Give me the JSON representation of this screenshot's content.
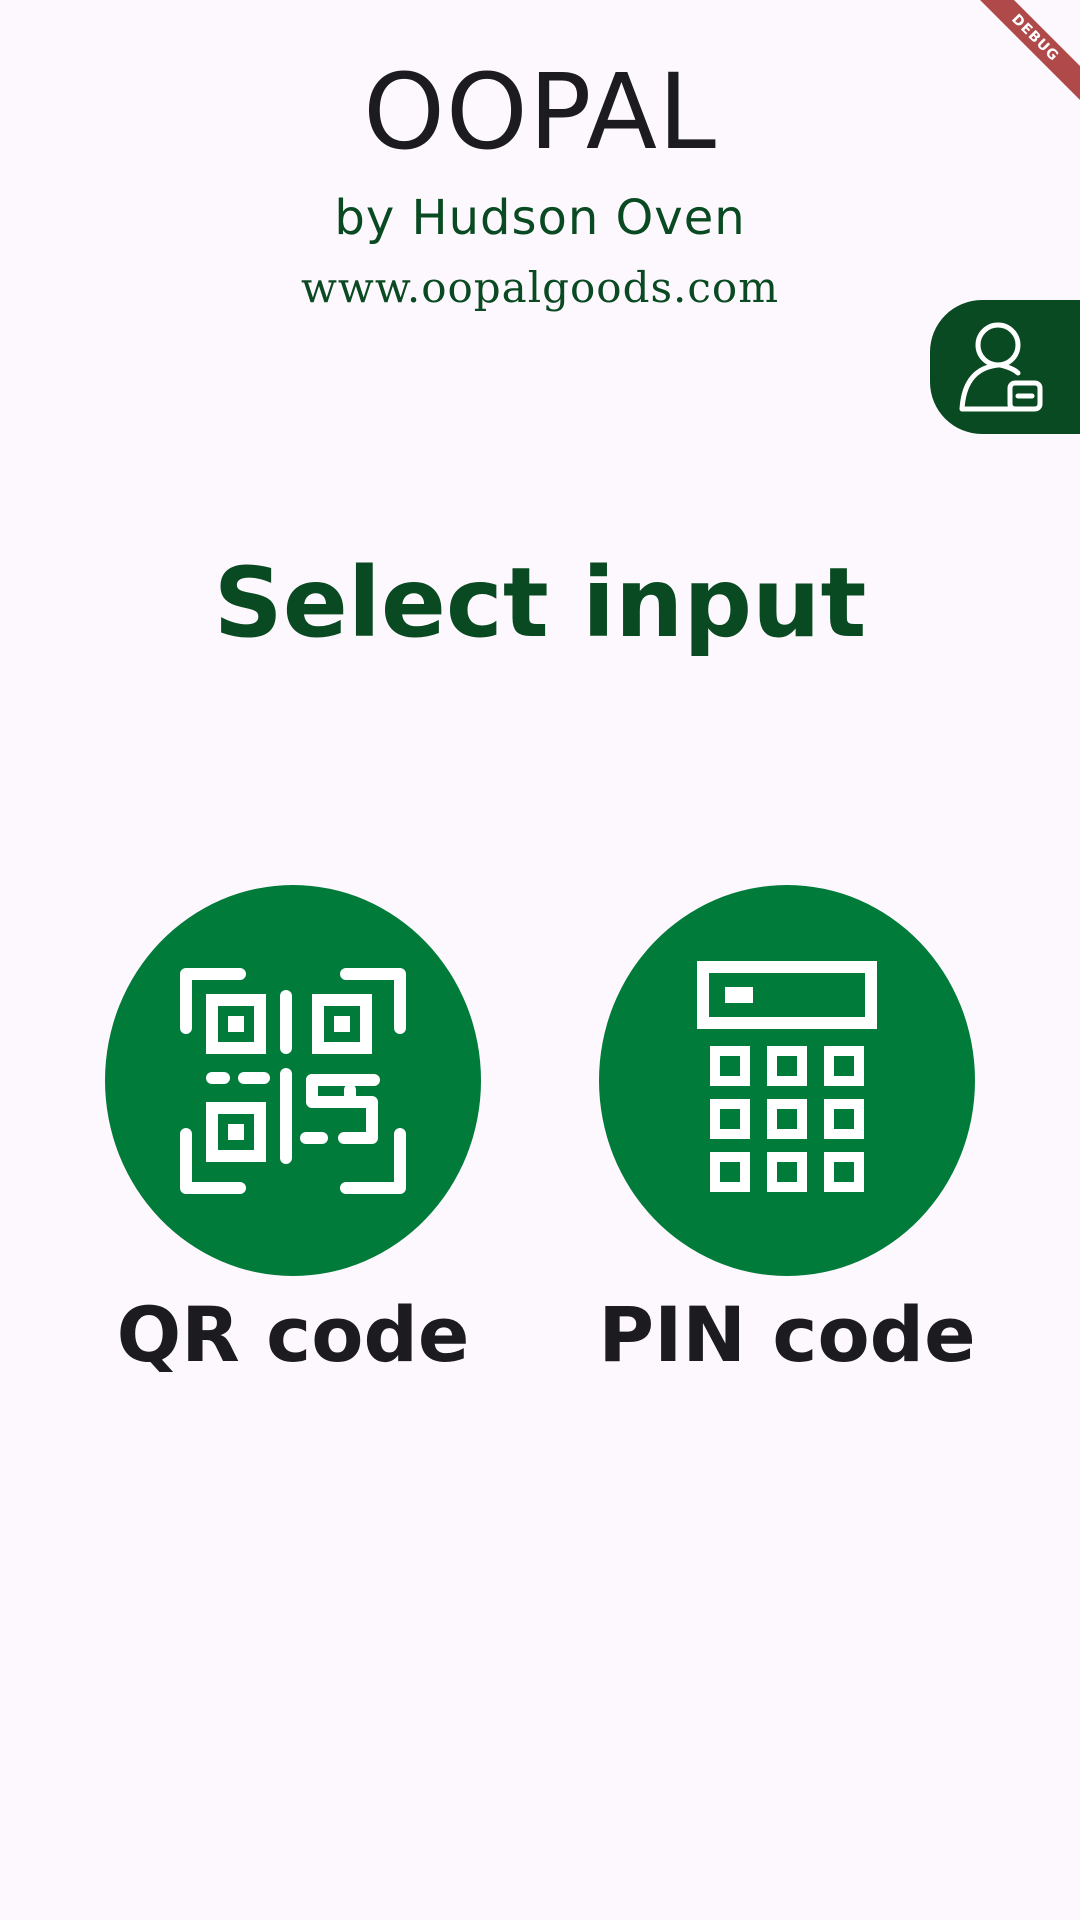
{
  "header": {
    "title": "OOPAL",
    "byline": "by Hudson Oven",
    "website": "www.oopalgoods.com"
  },
  "account_button": {
    "icon": "user-account-icon"
  },
  "heading": "Select input",
  "options": [
    {
      "label": "QR code",
      "icon": "qr-code-icon"
    },
    {
      "label": "PIN code",
      "icon": "calculator-icon"
    }
  ],
  "debug_banner": "DEBUG",
  "colors": {
    "background": "#fdf8fd",
    "primary_dark": "#0a4a22",
    "primary": "#007b3a",
    "text": "#1c1b1f",
    "debug": "#b04a4a"
  }
}
